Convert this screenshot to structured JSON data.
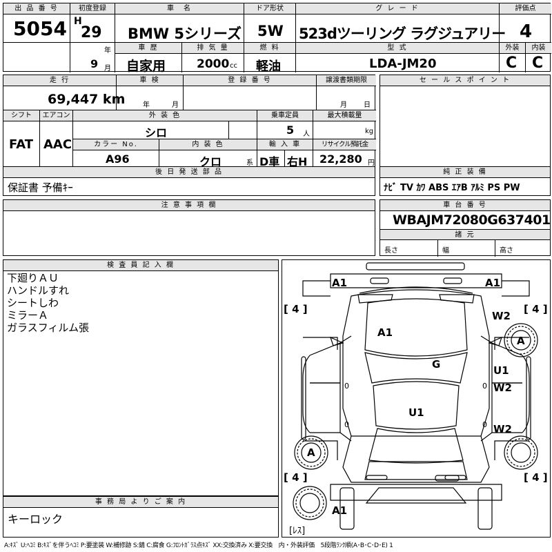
{
  "header": {
    "lot_label": "出 品 番 号",
    "lot_number": "5054",
    "first_reg_label": "初度登録",
    "era": "H",
    "year": "29",
    "year_unit": "年",
    "month": "9",
    "month_unit": "月",
    "car_name_label": "車　名",
    "car_name": "BMW 5シリーズ",
    "door_label": "ドア形状",
    "door": "5W",
    "grade_label": "グ レ ー ド",
    "grade": "523dツーリング ラグジュアリー",
    "score_label": "評価点",
    "score": "4",
    "history_label": "車 歴",
    "history": "自家用",
    "displacement_label": "排 気 量",
    "displacement": "2000",
    "displacement_unit": "cc",
    "fuel_label": "燃 料",
    "fuel": "軽油",
    "model_code_label": "型 式",
    "model_code": "LDA-JM20",
    "exterior_label": "外装",
    "exterior_grade": "C",
    "interior_label": "内装",
    "interior_grade": "C"
  },
  "specs": {
    "mileage_label": "走 行",
    "mileage": "69,447 km",
    "inspection_label": "車 検",
    "inspection_year_unit": "年",
    "inspection_month_unit": "月",
    "registration_label": "登 録 番 号",
    "transfer_label": "譲渡書類期限",
    "transfer_month_unit": "月",
    "transfer_day_unit": "日",
    "shift_label": "シフト",
    "shift": "FAT",
    "ac_label": "エアコン",
    "ac": "AAC",
    "ext_color_label": "外 装 色",
    "ext_color": "シロ",
    "capacity_label": "乗車定員",
    "capacity": "5",
    "capacity_unit": "人",
    "max_load_label": "最大積載量",
    "max_load_unit": "kg",
    "color_no_label": "カラー No.",
    "color_no": "A96",
    "int_color_label": "内 装 色",
    "int_color": "クロ",
    "int_color_suffix": "系",
    "import_label": "輸 入 車",
    "import_type": "D車",
    "steering": "右H",
    "recycle_label": "リサイクル預託金",
    "recycle": "22,280",
    "recycle_unit": "円",
    "later_parts_label": "後 日 発 送 部 品",
    "later_parts": "保証書 予備ｷｰ"
  },
  "sales": {
    "label": "セ ー ル ス ポ イ ン ト",
    "equipment_label": "純 正 装 備",
    "equipment": "ﾅﾋﾞ TV ｶﾜ ABS ｴｱB ｱﾙﾐ PS PW"
  },
  "notes": {
    "label": "注 意 事 項 欄"
  },
  "chassis": {
    "label": "車 台 番 号",
    "number": "WBAJM72080G637401",
    "dims_label": "諸 元",
    "length_label": "長さ",
    "width_label": "幅",
    "height_label": "高さ"
  },
  "inspector": {
    "label": "検 査 員 記 入 欄",
    "lines": [
      "下廻りＡＵ",
      "ハンドルすれ",
      "シートしわ",
      "ミラーＡ",
      "ガラスフィルム張"
    ]
  },
  "office": {
    "label": "事 務 局 よ り ご 案 内",
    "text": "キーロック"
  },
  "diagram": {
    "tires": [
      "[ 4 ]",
      "[ 4 ]",
      "[ 4 ]",
      "[ 4 ]"
    ],
    "spare_label": "[ﾚｽ]",
    "marks": {
      "front_left": "A1",
      "front_right": "A1",
      "hood": "A1",
      "fender_r": "W2",
      "wheel_fr": "A",
      "glass": "G",
      "door_fr_1": "U1",
      "door_fr_2": "W2",
      "roof": "U1",
      "door_rr": "W2",
      "wheel_rl": "A",
      "rear": "A1"
    },
    "zero": "0"
  },
  "legend": "A:ｷｽﾞ U:ﾍｺﾐ B:ｷｽﾞを伴うﾍｺﾐ P:要塗装 W:補修跡 S:錆 C:腐食 G:ﾌﾛﾝﾄｶﾞﾗｽ点ｷｽﾞ XX:交換済み X:要交換　内・外装評価　5段階ﾗﾝｸ順(A･B･C･D･E) 1"
}
